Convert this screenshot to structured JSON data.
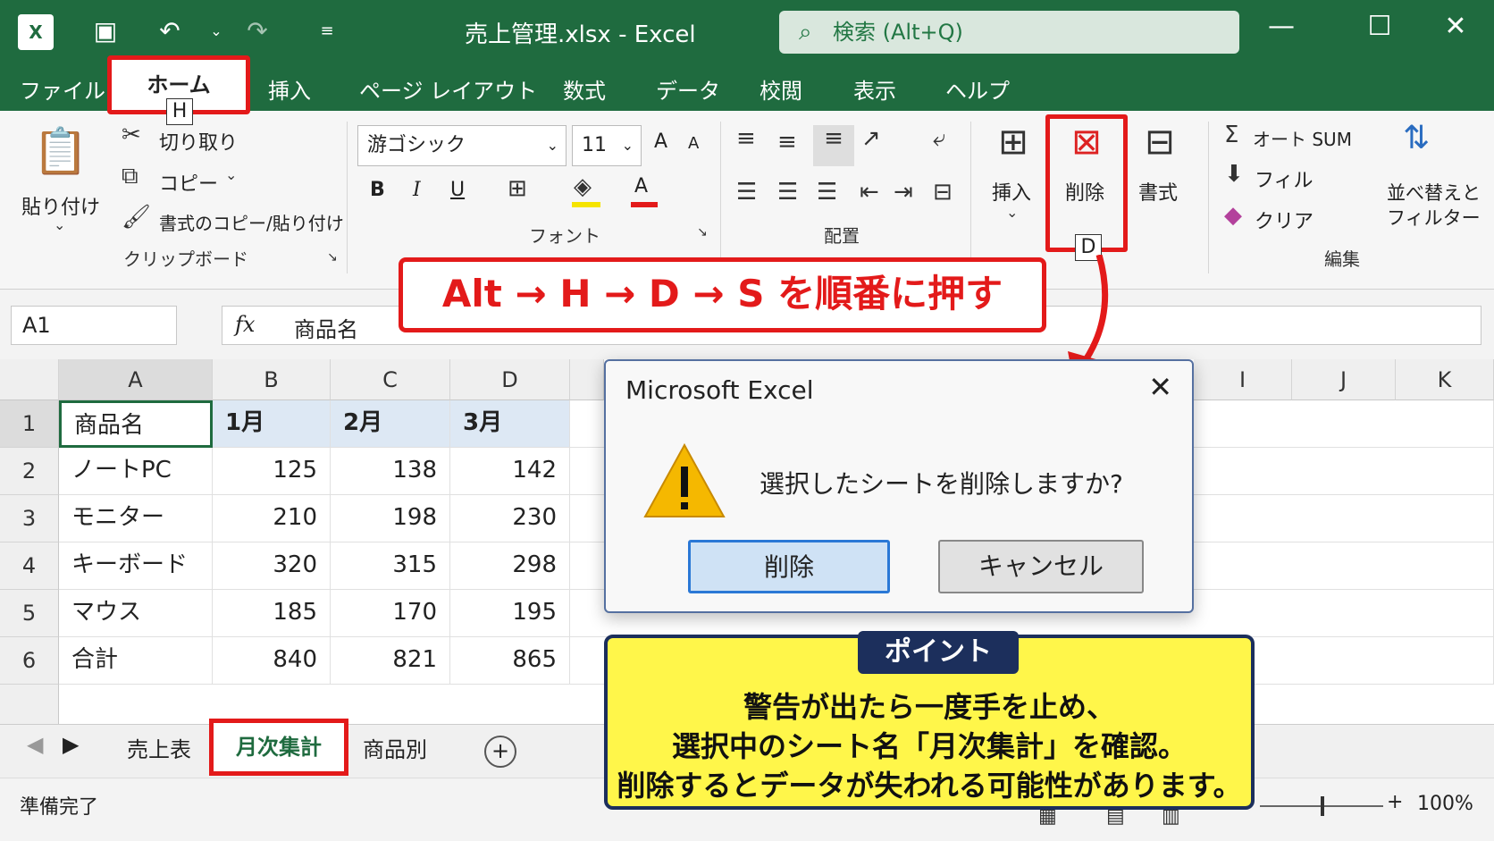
{
  "window": {
    "title": "売上管理.xlsx  -  Excel",
    "logo": "X",
    "search_placeholder": "検索 (Alt+Q)",
    "qat": [
      "save-icon",
      "undo-icon",
      "redo-icon",
      "customize-icon"
    ]
  },
  "menu": {
    "tabs": [
      "ファイル",
      "ホーム",
      "挿入",
      "ページ レイアウト",
      "数式",
      "データ",
      "校閲",
      "表示",
      "ヘルプ"
    ],
    "active": "ホーム",
    "keytip_home": "H",
    "keytip_delete": "D"
  },
  "ribbon": {
    "clipboard": {
      "paste": "貼り付け",
      "cut": "切り取り",
      "copy": "コピー",
      "format_painter": "書式のコピー/貼り付け",
      "label": "クリップボード"
    },
    "font": {
      "name": "游ゴシック",
      "size": "11",
      "label": "フォント",
      "bold": "B",
      "italic": "I",
      "underline": "U",
      "font_color": "A",
      "grow": "A",
      "shrink": "A"
    },
    "alignment": {
      "label": "配置"
    },
    "cells": {
      "insert": "挿入",
      "delete": "削除",
      "format": "書式"
    },
    "editing": {
      "autosum": "オート SUM",
      "fill": "フィル",
      "clear": "クリア",
      "sort_line1": "並べ替えと",
      "sort_line2": "フィルター",
      "label": "編集"
    }
  },
  "formula_bar": {
    "name_box": "A1",
    "fx": "fx",
    "value": "商品名"
  },
  "grid": {
    "columns": [
      "A",
      "B",
      "C",
      "D",
      "I",
      "J",
      "K"
    ],
    "rows": [
      {
        "n": "1",
        "cells": [
          "商品名",
          "1月",
          "2月",
          "3月"
        ]
      },
      {
        "n": "2",
        "cells": [
          "ノートPC",
          "125",
          "138",
          "142"
        ]
      },
      {
        "n": "3",
        "cells": [
          "モニター",
          "210",
          "198",
          "230"
        ]
      },
      {
        "n": "4",
        "cells": [
          "キーボード",
          "320",
          "315",
          "298"
        ]
      },
      {
        "n": "5",
        "cells": [
          "マウス",
          "185",
          "170",
          "195"
        ]
      },
      {
        "n": "6",
        "cells": [
          "合計",
          "840",
          "821",
          "865"
        ]
      }
    ]
  },
  "sheets": {
    "tabs": [
      "売上表",
      "月次集計",
      "商品別"
    ],
    "active": "月次集計",
    "add": "+"
  },
  "status": {
    "ready": "準備完了",
    "zoom": "100%"
  },
  "callout": "Alt → H → D → S を順番に押す",
  "dialog": {
    "title": "Microsoft Excel",
    "message": "選択したシートを削除しますか?",
    "delete_label": "削除",
    "cancel_label": "キャンセル"
  },
  "point": {
    "tag": "ポイント",
    "line1": "警告が出たら一度手を止め、",
    "line2": "選択中のシート名「月次集計」を確認。",
    "line3": "削除するとデータが失われる可能性があります。"
  },
  "colors": {
    "excel_green": "#1f6b3f",
    "highlight_red": "#e31a1a",
    "point_yellow": "#fff64a",
    "point_navy": "#1c2f5c"
  }
}
